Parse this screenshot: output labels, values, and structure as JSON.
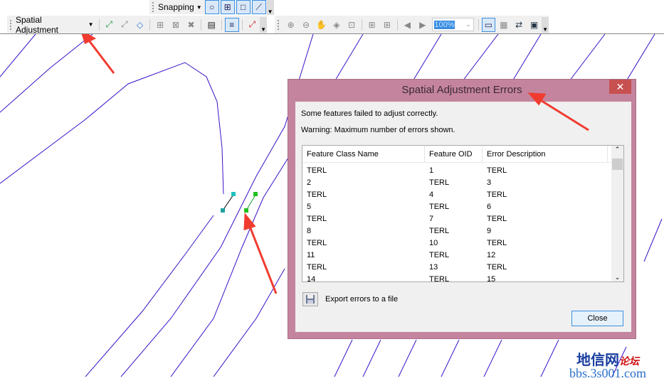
{
  "toolbar": {
    "spatial_adjustment_label": "Spatial Adjustment",
    "snapping_label": "Snapping",
    "zoom_value": "100%"
  },
  "dialog": {
    "title": "Spatial Adjustment Errors",
    "close_x": "✕",
    "message": "Some features failed to adjust correctly.",
    "warning": "Warning: Maximum number of errors shown.",
    "columns": [
      "Feature Class Name",
      "Feature OID",
      "Error Description"
    ],
    "rows": [
      [
        "TERL",
        "1",
        "TERL"
      ],
      [
        "2",
        "TERL",
        "3"
      ],
      [
        "TERL",
        "4",
        "TERL"
      ],
      [
        "5",
        "TERL",
        "6"
      ],
      [
        "TERL",
        "7",
        "TERL"
      ],
      [
        "8",
        "TERL",
        "9"
      ],
      [
        "TERL",
        "10",
        "TERL"
      ],
      [
        "11",
        "TERL",
        "12"
      ],
      [
        "TERL",
        "13",
        "TERL"
      ],
      [
        "14",
        "TERL",
        "15"
      ]
    ],
    "export_label": "Export errors to a file",
    "close_label": "Close"
  },
  "watermark": {
    "line1": "地信网",
    "line1_accent": "论坛",
    "line2": "bbs.3s001.com"
  },
  "colors": {
    "map_lines": "#3a10c8",
    "dialog_frame": "#c5849e",
    "arrow": "#f03c30"
  }
}
